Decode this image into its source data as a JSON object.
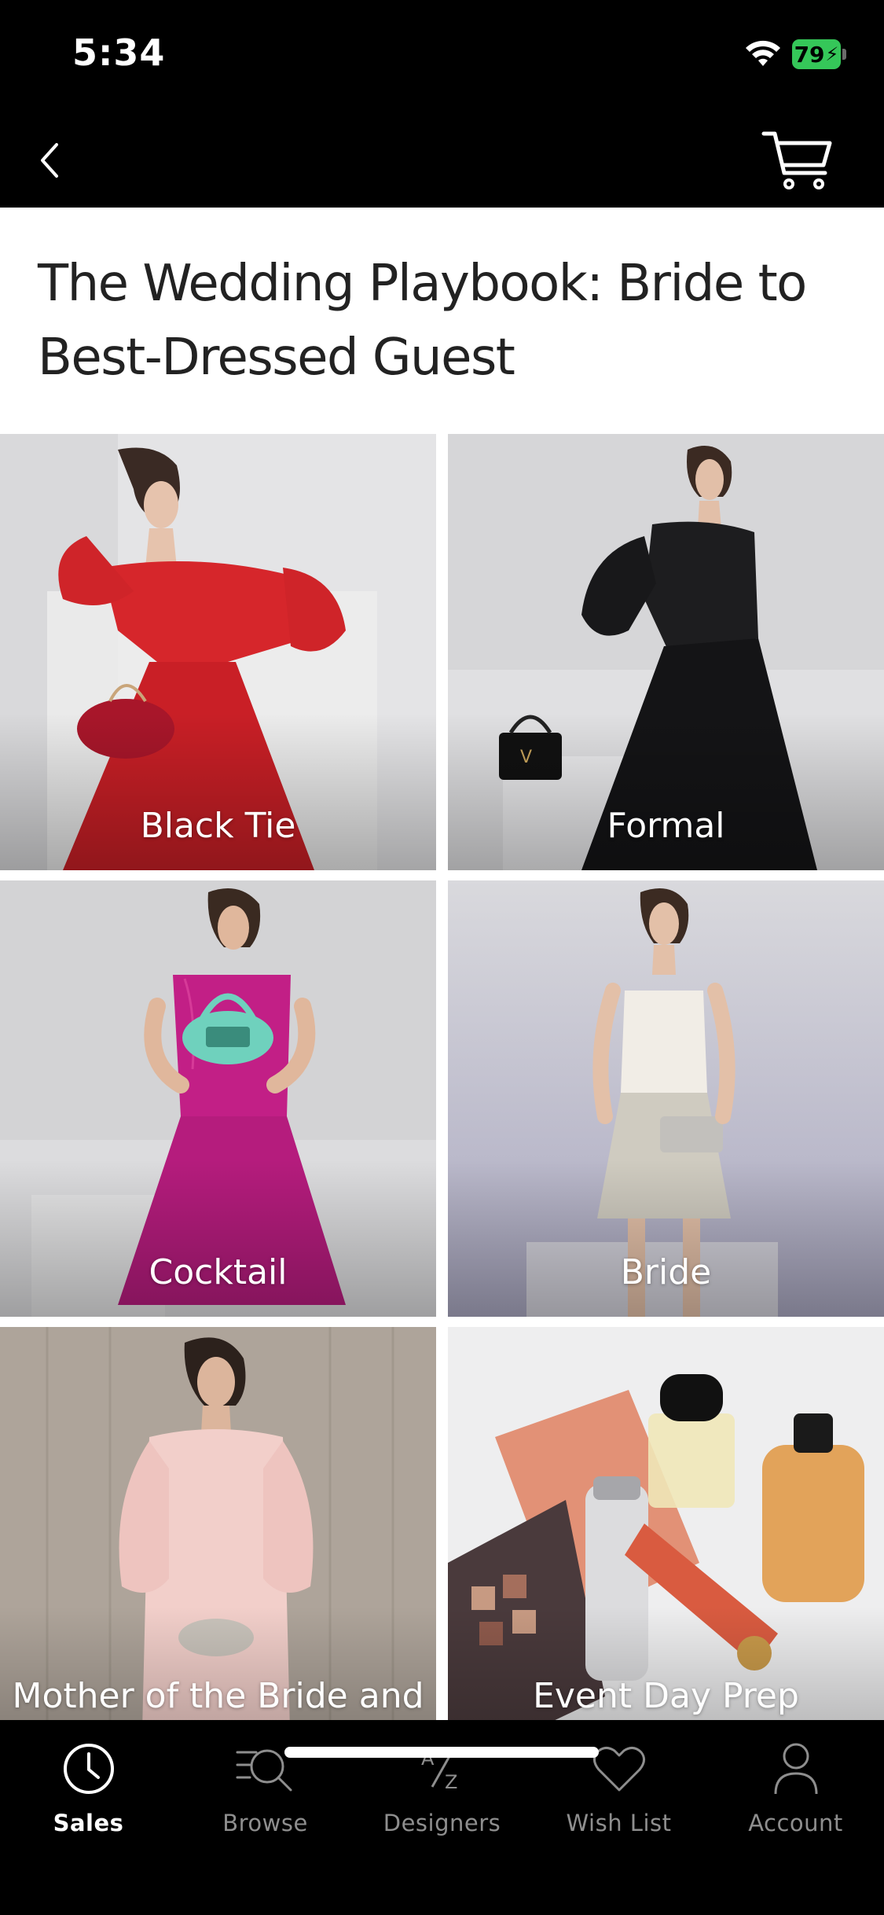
{
  "status_bar": {
    "time": "5:34",
    "battery_level": "79",
    "battery_charging": true
  },
  "nav": {
    "back_icon": "chevron-left-icon",
    "cart_icon": "shopping-cart-icon"
  },
  "page": {
    "title": "The Wedding Playbook: Bride to Best-Dressed Guest"
  },
  "categories": [
    {
      "label": "Black Tie"
    },
    {
      "label": "Formal"
    },
    {
      "label": "Cocktail"
    },
    {
      "label": "Bride"
    },
    {
      "label": "Mother of the Bride and Groom"
    },
    {
      "label": "Event Day Prep"
    }
  ],
  "tabs": [
    {
      "label": "Sales",
      "icon": "clock-icon",
      "active": true
    },
    {
      "label": "Browse",
      "icon": "search-lines-icon",
      "active": false
    },
    {
      "label": "Designers",
      "icon": "a-z-icon",
      "active": false
    },
    {
      "label": "Wish List",
      "icon": "heart-icon",
      "active": false
    },
    {
      "label": "Account",
      "icon": "person-icon",
      "active": false
    }
  ],
  "colors": {
    "background": "#000000",
    "content_background": "#ffffff",
    "title_text": "#222222",
    "tab_active": "#ffffff",
    "tab_inactive": "#8e8e8e",
    "battery": "#35c759"
  }
}
